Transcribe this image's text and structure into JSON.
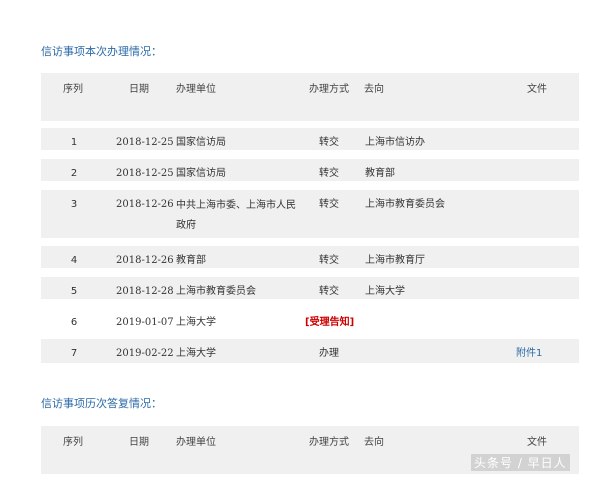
{
  "section1": {
    "title": "信访事项本次办理情况：",
    "headers": {
      "index": "序列",
      "date": "日期",
      "unit": "办理单位",
      "method": "办理方式",
      "dest": "去向",
      "file": "文件"
    },
    "rows": [
      {
        "index": "1",
        "date": "2018-12-25",
        "unit": "国家信访局",
        "method": "转交",
        "dest": "上海市信访办",
        "file": ""
      },
      {
        "index": "2",
        "date": "2018-12-25",
        "unit": "国家信访局",
        "method": "转交",
        "dest": "教育部",
        "file": ""
      },
      {
        "index": "3",
        "date": "2018-12-26",
        "unit": "中共上海市委、上海市人民政府",
        "method": "转交",
        "dest": "上海市教育委员会",
        "file": ""
      },
      {
        "index": "4",
        "date": "2018-12-26",
        "unit": "教育部",
        "method": "转交",
        "dest": "上海市教育厅",
        "file": ""
      },
      {
        "index": "5",
        "date": "2018-12-28",
        "unit": "上海市教育委员会",
        "method": "转交",
        "dest": "上海大学",
        "file": ""
      },
      {
        "index": "6",
        "date": "2019-01-07",
        "unit": "上海大学",
        "method": "[受理告知]",
        "dest": "",
        "file": ""
      },
      {
        "index": "7",
        "date": "2019-02-22",
        "unit": "上海大学",
        "method": "办理",
        "dest": "",
        "file": "附件1"
      }
    ]
  },
  "section2": {
    "title": "信访事项历次答复情况：",
    "headers": {
      "index": "序列",
      "date": "日期",
      "unit": "办理单位",
      "method": "办理方式",
      "dest": "去向",
      "file": "文件"
    }
  },
  "watermark": "头条号 / 早日人"
}
